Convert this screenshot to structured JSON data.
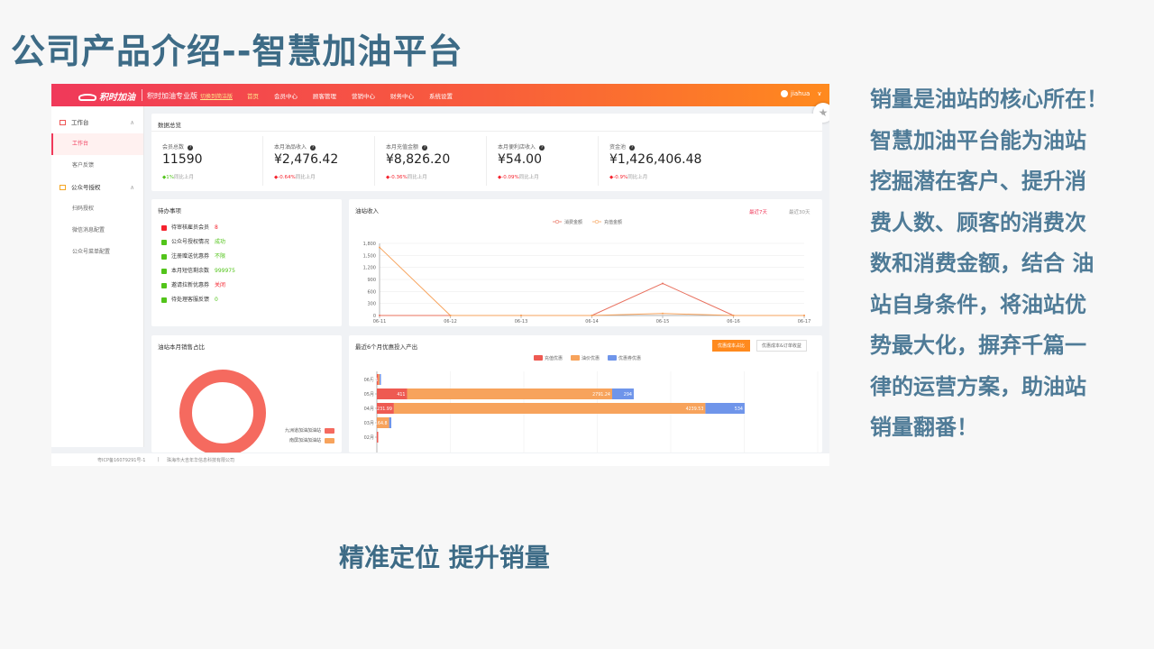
{
  "slide": {
    "title": "公司产品介绍--智慧加油平台",
    "side_lines": [
      "销量是油站的核心所在！",
      "智慧加油平台能为油站",
      "挖掘潜在客户、提升消",
      "费人数、顾客的消费次",
      "数和消费金额，结合 油",
      "站自身条件，将油站优",
      "势最大化，摒弃千篇一",
      "律的运营方案，助油站",
      "销量翻番！"
    ],
    "caption": "精准定位  提升销量"
  },
  "app": {
    "logo": "积时加油",
    "product": "积时加油专业版",
    "switch_label": "切换到简洁版",
    "nav": [
      "首页",
      "会员中心",
      "顾客管理",
      "营销中心",
      "财务中心",
      "系统设置"
    ],
    "user": "jiahua",
    "user_chevron": "∨",
    "fav_icon": "star-icon",
    "brand_colors": {
      "start": "#f0395a",
      "end": "#ff8a1e"
    }
  },
  "sidebar": {
    "groups": [
      {
        "label": "工作台",
        "chevron": "∧",
        "items": [
          "工作台",
          "客户反馈"
        ]
      },
      {
        "label": "公众号授权",
        "chevron": "∧",
        "items": [
          "扫码授权",
          "微信消息配置",
          "公众号菜单配置"
        ]
      }
    ]
  },
  "overview": {
    "title": "数据总览",
    "stats": [
      {
        "label": "会员总数",
        "value": "11590",
        "change": "1%",
        "suffix": "同比上月",
        "dir": "up"
      },
      {
        "label": "本月油品收入",
        "value": "¥2,476.42",
        "change": "-0.64%",
        "suffix": "同比上月",
        "dir": "down"
      },
      {
        "label": "本月充值金额",
        "value": "¥8,826.20",
        "change": "-0.36%",
        "suffix": "同比上月",
        "dir": "down"
      },
      {
        "label": "本月便利店收入",
        "value": "¥54.00",
        "change": "-0.09%",
        "suffix": "同比上月",
        "dir": "down"
      },
      {
        "label": "资金池",
        "value": "¥1,426,406.48",
        "change": "-0.9%",
        "suffix": "同比上月",
        "dir": "down"
      }
    ]
  },
  "todo": {
    "title": "待办事项",
    "items": [
      {
        "label": "待审核雇员会员",
        "value": "8",
        "status": "warn",
        "color": "red"
      },
      {
        "label": "公众号授权情况",
        "value": "成功",
        "status": "ok",
        "color": "green"
      },
      {
        "label": "注册赠送优惠券",
        "value": "不限",
        "status": "ok",
        "color": "green"
      },
      {
        "label": "本月短信剩余数",
        "value": "999975",
        "status": "ok",
        "color": "green"
      },
      {
        "label": "邀请拉新优惠券",
        "value": "关闭",
        "status": "ok",
        "color": "red"
      },
      {
        "label": "待处理客服反馈",
        "value": "0",
        "status": "ok",
        "color": "green"
      }
    ]
  },
  "income": {
    "title": "油站收入",
    "tab_7": "最近7天",
    "tab_30": "最近30天"
  },
  "sales_share": {
    "title": "油站本月销售占比",
    "legend": [
      "九洲道加油加油站",
      "南屏加油加油站"
    ],
    "colors": [
      "#f56a5f",
      "#f7a35c"
    ]
  },
  "promo": {
    "title": "最近6个月优惠投入产出",
    "tab_cost": "优惠成本占比",
    "tab_compare": "优惠成本&订单收益"
  },
  "footer": {
    "icp": "粤ICP备16079291号-1",
    "sep": "|",
    "company": "珠海市大吉年华信息科技有限公司"
  },
  "chart_data": [
    {
      "type": "line",
      "title": "油站收入",
      "x": [
        "06-11",
        "06-12",
        "06-13",
        "06-14",
        "06-15",
        "06-16",
        "06-17"
      ],
      "series": [
        {
          "name": "消费金额",
          "values": [
            0,
            0,
            0,
            0,
            800,
            0,
            0
          ],
          "color": "#e8705e"
        },
        {
          "name": "充值金额",
          "values": [
            1700,
            0,
            0,
            0,
            50,
            0,
            0
          ],
          "color": "#f7a35c"
        }
      ],
      "yticks": [
        0,
        300,
        600,
        900,
        1200,
        1500,
        1800
      ],
      "ylim": [
        0,
        1800
      ],
      "legend": "top-center"
    },
    {
      "type": "bar",
      "title": "最近6个月优惠投入产出",
      "orientation": "horizontal",
      "stacked": true,
      "categories": [
        "06月",
        "05月",
        "04月",
        "03月",
        "02月"
      ],
      "series": [
        {
          "name": "充值优惠",
          "values": [
            20,
            411,
            231.99,
            2,
            2
          ],
          "color": "#ee5a52"
        },
        {
          "name": "油价优惠",
          "values": [
            17.6,
            2791.24,
            4239.53,
            164.8,
            0
          ],
          "color": "#f7a35c"
        },
        {
          "name": "优惠券优惠",
          "values": [
            4,
            294,
            534,
            30,
            0
          ],
          "color": "#6f95ea"
        }
      ],
      "labels": [
        [
          "20",
          "17.6",
          ""
        ],
        [
          "411",
          "2791.24",
          "294"
        ],
        [
          "231.99",
          "4239.53",
          "534"
        ],
        [
          "",
          "164.8",
          ""
        ],
        [
          "",
          "",
          ""
        ]
      ],
      "xlim": [
        0,
        6000
      ],
      "legend": "top-center"
    },
    {
      "type": "pie",
      "title": "油站本月销售占比",
      "categories": [
        "九洲道加油加油站",
        "南屏加油加油站"
      ],
      "values": [
        100,
        0
      ],
      "colors": [
        "#f56a5f",
        "#f7a35c"
      ]
    }
  ]
}
